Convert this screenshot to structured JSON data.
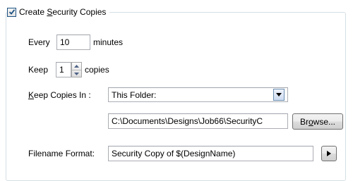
{
  "group": {
    "checkbox_label_pre": "Create ",
    "checkbox_label_accel": "S",
    "checkbox_label_post": "ecurity Copies",
    "checked": true
  },
  "every": {
    "label": "Every",
    "value": "10",
    "unit": "minutes"
  },
  "keep": {
    "label": "Keep",
    "value": "1",
    "unit": "copies"
  },
  "keep_copies_in": {
    "label_accel": "K",
    "label_rest": "eep Copies In :",
    "selected": "This Folder:",
    "path": "C:\\Documents\\Designs\\Job66\\SecurityC",
    "browse_pre": "Br",
    "browse_accel": "o",
    "browse_post": "wse..."
  },
  "filename_format": {
    "label": "Filename Format:",
    "value": "Security Copy of $(DesignName)"
  },
  "colors": {
    "check": "#1c5180",
    "groupbox_border": "#d5dfe5"
  }
}
